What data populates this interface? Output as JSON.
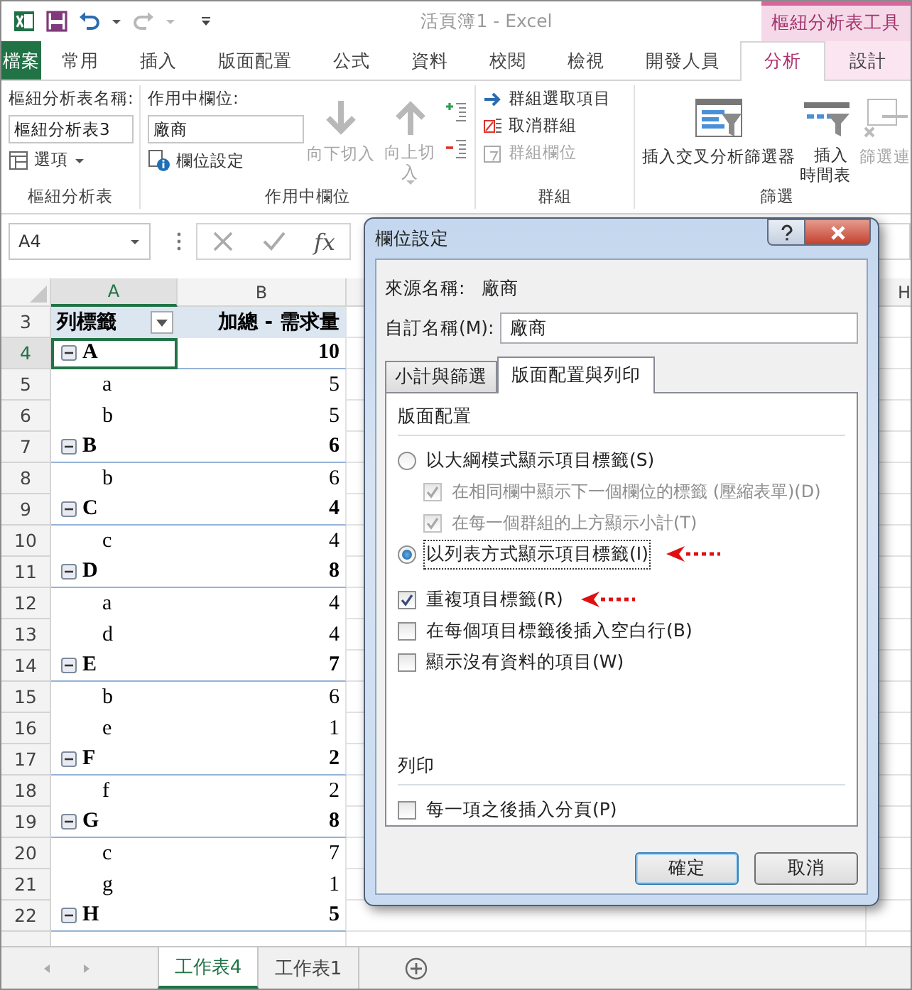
{
  "window": {
    "title": "活頁簿1 - Excel",
    "context_tab_group": "樞紐分析表工具"
  },
  "tabs": [
    {
      "label": "檔案",
      "kind": "file",
      "selected": false
    },
    {
      "label": "常用",
      "kind": "normal",
      "selected": false
    },
    {
      "label": "插入",
      "kind": "normal",
      "selected": false
    },
    {
      "label": "版面配置",
      "kind": "normal",
      "selected": false
    },
    {
      "label": "公式",
      "kind": "normal",
      "selected": false
    },
    {
      "label": "資料",
      "kind": "normal",
      "selected": false
    },
    {
      "label": "校閱",
      "kind": "normal",
      "selected": false
    },
    {
      "label": "檢視",
      "kind": "normal",
      "selected": false
    },
    {
      "label": "開發人員",
      "kind": "normal",
      "selected": false
    },
    {
      "label": "分析",
      "kind": "context",
      "selected": true
    },
    {
      "label": "設計",
      "kind": "context",
      "selected": false
    }
  ],
  "ribbon": {
    "pivot_table": {
      "name_label": "樞紐分析表名稱:",
      "name_value": "樞紐分析表3",
      "options": "選項",
      "group_label": "樞紐分析表"
    },
    "active_field": {
      "field_label": "作用中欄位:",
      "field_value": "廠商",
      "field_settings": "欄位設定",
      "drill_down": {
        "label": "向下切入",
        "disabled": true
      },
      "drill_up": {
        "label": "向上切入",
        "disabled": true
      },
      "group_label": "作用中欄位"
    },
    "group": {
      "group_selection": {
        "label": "群組選取項目",
        "disabled": false
      },
      "ungroup": {
        "label": "取消群組",
        "disabled": false
      },
      "group_field": {
        "label": "群組欄位",
        "disabled": true
      },
      "group_label": "群組"
    },
    "filter": {
      "insert_slicer": {
        "label": "插入交叉分析篩選器",
        "disabled": false
      },
      "insert_timeline": {
        "label": "插入時間表",
        "disabled": false
      },
      "filter_connections": {
        "label": "篩選連",
        "disabled": true
      },
      "group_label": "篩選"
    }
  },
  "formula_bar": {
    "name_box": "A4",
    "function_button": "fx"
  },
  "sheet": {
    "columns": [
      {
        "label": "A",
        "selected": true
      },
      {
        "label": "B",
        "selected": false
      }
    ],
    "right_column": "H",
    "rows": [
      {
        "num": "3",
        "kind": "header",
        "label": "列標籤",
        "value": "加總 - 需求量",
        "selected": false
      },
      {
        "num": "4",
        "kind": "group",
        "label": "A",
        "value": "10",
        "expanded": true,
        "selected": true
      },
      {
        "num": "5",
        "kind": "item",
        "label": "a",
        "value": "5",
        "selected": false
      },
      {
        "num": "6",
        "kind": "item",
        "label": "b",
        "value": "5",
        "selected": false
      },
      {
        "num": "7",
        "kind": "group",
        "label": "B",
        "value": "6",
        "expanded": true,
        "selected": false
      },
      {
        "num": "8",
        "kind": "item",
        "label": "b",
        "value": "6",
        "selected": false
      },
      {
        "num": "9",
        "kind": "group",
        "label": "C",
        "value": "4",
        "expanded": true,
        "selected": false
      },
      {
        "num": "10",
        "kind": "item",
        "label": "c",
        "value": "4",
        "selected": false
      },
      {
        "num": "11",
        "kind": "group",
        "label": "D",
        "value": "8",
        "expanded": true,
        "selected": false
      },
      {
        "num": "12",
        "kind": "item",
        "label": "a",
        "value": "4",
        "selected": false
      },
      {
        "num": "13",
        "kind": "item",
        "label": "d",
        "value": "4",
        "selected": false
      },
      {
        "num": "14",
        "kind": "group",
        "label": "E",
        "value": "7",
        "expanded": true,
        "selected": false
      },
      {
        "num": "15",
        "kind": "item",
        "label": "b",
        "value": "6",
        "selected": false
      },
      {
        "num": "16",
        "kind": "item",
        "label": "e",
        "value": "1",
        "selected": false
      },
      {
        "num": "17",
        "kind": "group",
        "label": "F",
        "value": "2",
        "expanded": true,
        "selected": false
      },
      {
        "num": "18",
        "kind": "item",
        "label": "f",
        "value": "2",
        "selected": false
      },
      {
        "num": "19",
        "kind": "group",
        "label": "G",
        "value": "8",
        "expanded": true,
        "selected": false
      },
      {
        "num": "20",
        "kind": "item",
        "label": "c",
        "value": "7",
        "selected": false
      },
      {
        "num": "21",
        "kind": "item",
        "label": "g",
        "value": "1",
        "selected": false
      },
      {
        "num": "22",
        "kind": "group",
        "label": "H",
        "value": "5",
        "expanded": true,
        "selected": false
      }
    ]
  },
  "sheet_tabs": [
    {
      "label": "工作表4",
      "selected": true
    },
    {
      "label": "工作表1",
      "selected": false
    }
  ],
  "dialog": {
    "title": "欄位設定",
    "source_label": "來源名稱:",
    "source_value": "廠商",
    "custom_name_label": "自訂名稱(M):",
    "custom_name_value": "廠商",
    "tabs": [
      {
        "label": "小計與篩選",
        "selected": false
      },
      {
        "label": "版面配置與列印",
        "selected": true
      }
    ],
    "layout_heading": "版面配置",
    "layout_options": [
      {
        "kind": "radio",
        "label": "以大綱模式顯示項目標籤(S)",
        "selected": false,
        "focused": false,
        "annotated": false,
        "children": [
          {
            "kind": "checkbox",
            "label": "在相同欄中顯示下一個欄位的標籤 (壓縮表單)(D)",
            "checked": true,
            "disabled": true
          },
          {
            "kind": "checkbox",
            "label": "在每一個群組的上方顯示小計(T)",
            "checked": true,
            "disabled": true
          }
        ]
      },
      {
        "kind": "radio",
        "label": "以列表方式顯示項目標籤(I)",
        "selected": true,
        "focused": true,
        "annotated": true
      },
      {
        "kind": "checkbox",
        "label": "重複項目標籤(R)",
        "checked": true,
        "annotated": true
      },
      {
        "kind": "checkbox",
        "label": "在每個項目標籤後插入空白行(B)",
        "checked": false,
        "annotated": false
      },
      {
        "kind": "checkbox",
        "label": "顯示沒有資料的項目(W)",
        "checked": false,
        "annotated": false
      }
    ],
    "print_heading": "列印",
    "print_options": [
      {
        "kind": "checkbox",
        "label": "每一項之後插入分頁(P)",
        "checked": false
      }
    ],
    "buttons": [
      {
        "label": "確定",
        "default": true
      },
      {
        "label": "取消",
        "default": false
      }
    ]
  }
}
